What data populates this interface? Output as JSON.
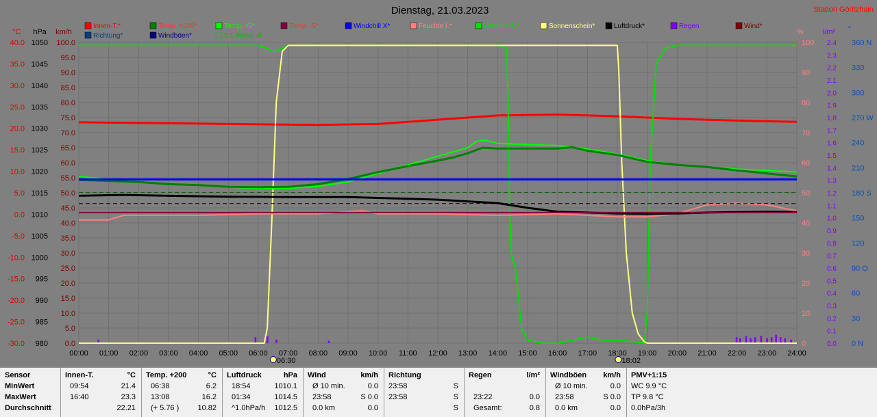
{
  "chart_data": {
    "type": "line",
    "title": "Dienstag, 21.03.2023",
    "station": "Station Göritzhain",
    "background": "#808080",
    "grid": true,
    "x": {
      "min_hours": 0,
      "max_hours": 24,
      "ticks": [
        "00:00",
        "01:00",
        "02:00",
        "03:00",
        "04:00",
        "05:00",
        "06:00",
        "07:00",
        "08:00",
        "09:00",
        "10:00",
        "11:00",
        "12:00",
        "13:00",
        "14:00",
        "15:00",
        "16:00",
        "17:00",
        "18:00",
        "19:00",
        "20:00",
        "21:00",
        "22:00",
        "23:00",
        "24:00"
      ]
    },
    "axes": {
      "temp": {
        "unit": "°C",
        "color": "#e00000",
        "range": [
          -30,
          40
        ],
        "ticks": [
          "40.0",
          "35.0",
          "30.0",
          "25.0",
          "20.0",
          "15.0",
          "10.0",
          "5.0",
          "0.0",
          "-5.0",
          "-10.0",
          "-15.0",
          "-20.0",
          "-25.0",
          "-30.0"
        ]
      },
      "pressure": {
        "unit": "hPa",
        "color": "#000000",
        "range": [
          980,
          1050
        ],
        "ticks": [
          "1050",
          "1045",
          "1040",
          "1035",
          "1030",
          "1025",
          "1020",
          "1015",
          "1010",
          "1005",
          "1000",
          "995",
          "990",
          "985",
          "980"
        ]
      },
      "wind": {
        "unit": "km/h",
        "color": "#800000",
        "range": [
          0,
          100
        ],
        "ticks": [
          "100.0",
          "95.0",
          "90.0",
          "85.0",
          "80.0",
          "75.0",
          "70.0",
          "65.0",
          "60.0",
          "55.0",
          "50.0",
          "45.0",
          "40.0",
          "35.0",
          "30.0",
          "25.0",
          "20.0",
          "15.0",
          "10.0",
          "5.0",
          "0.0"
        ]
      },
      "humidity": {
        "unit": "%",
        "color": "#ff8080",
        "range": [
          0,
          100
        ],
        "ticks": [
          "100",
          "90",
          "80",
          "70",
          "60",
          "50",
          "40",
          "30",
          "20",
          "10",
          "0"
        ]
      },
      "rain": {
        "unit": "l/m²",
        "color": "#8000ff",
        "range": [
          0,
          2.5
        ],
        "ticks": [
          "2.4",
          "2.3",
          "2.2",
          "2.1",
          "2.0",
          "1.9",
          "1.8",
          "1.7",
          "1.6",
          "1.5",
          "1.4",
          "1.3",
          "1.2",
          "1.1",
          "1.0",
          "0.9",
          "0.8",
          "0.7",
          "0.6",
          "0.5",
          "0.4",
          "0.3",
          "0.2",
          "0.1",
          "0.0"
        ]
      },
      "direction": {
        "unit": "°",
        "color": "#0050c0",
        "range": [
          0,
          360
        ],
        "ticks": [
          "360 N",
          "330",
          "300",
          "270 W",
          "240",
          "210",
          "180 S",
          "150",
          "120",
          "90 O",
          "60",
          "30",
          "0 N"
        ]
      }
    },
    "legend": [
      {
        "label": "Innen-T.*",
        "color": "#ff0000"
      },
      {
        "label": "Temp. +200*",
        "color": "#008000"
      },
      {
        "label": "Temp. +5*",
        "color": "#00ff00"
      },
      {
        "label": "Temp. -5*",
        "color": "#800040"
      },
      {
        "label": "Windchill X*",
        "color": "#0000ff"
      },
      {
        "label": "Feuchte I.*",
        "color": "#ff8080"
      },
      {
        "label": "Feuchte A.*",
        "color": "#00e000"
      },
      {
        "label": "Sonnenschein*",
        "color": "#ffff80"
      },
      {
        "label": "Luftdruck*",
        "color": "#000000"
      },
      {
        "label": "Regen",
        "color": "#8000ff"
      },
      {
        "label": "Wind*",
        "color": "#800000"
      },
      {
        "label": "Richtung*",
        "color": "#004080"
      },
      {
        "label": "Windböen*",
        "color": "#000080"
      },
      {
        "label": "5.1 Monat-Ø",
        "color": "#00c000"
      }
    ],
    "markers": [
      {
        "x": 6.5,
        "label": "06:30"
      },
      {
        "x": 18.033,
        "label": "18:02"
      }
    ],
    "series": [
      {
        "name": "Innen-T.*",
        "axis": "temp",
        "color": "#ff0000",
        "width": 3,
        "x": [
          0,
          3,
          5,
          8,
          10,
          12,
          14,
          16,
          18,
          20,
          22,
          24
        ],
        "y": [
          21.4,
          21.2,
          21.0,
          20.8,
          21.0,
          22.0,
          23.0,
          23.2,
          22.8,
          22.2,
          21.8,
          21.5
        ]
      },
      {
        "name": "Feuchte A.*",
        "axis": "humidity",
        "color": "#00e000",
        "width": 2,
        "x": [
          0,
          6.0,
          6.3,
          6.45,
          6.6,
          6.8,
          7.0,
          14.1,
          14.3,
          14.35,
          14.4,
          14.45,
          14.5,
          14.6,
          14.8,
          15.0,
          15.5,
          16.0,
          16.5,
          17.0,
          17.5,
          18.0,
          18.5,
          18.9,
          19.0,
          19.1,
          19.3,
          19.6,
          20.0,
          24
        ],
        "y": [
          99,
          99,
          98,
          97,
          97,
          98,
          99,
          99,
          98,
          80,
          45,
          30,
          28,
          25,
          5,
          1,
          0,
          0,
          1,
          2,
          1,
          1,
          0.5,
          0,
          10,
          60,
          93,
          98,
          99,
          99
        ]
      },
      {
        "name": "Sonnenschein*",
        "axis": "humidity",
        "color": "#ffff80",
        "width": 2,
        "x": [
          0,
          6.2,
          6.3,
          6.45,
          6.6,
          6.8,
          7.0,
          7.3,
          18.0,
          18.05,
          18.15,
          18.3,
          18.5,
          18.7,
          18.9,
          19.0,
          24
        ],
        "y": [
          0,
          0,
          5,
          40,
          80,
          97,
          99,
          99,
          99,
          90,
          60,
          30,
          10,
          3,
          0.5,
          0,
          0
        ]
      },
      {
        "name": "Temp. +5*",
        "axis": "temp",
        "color": "#00ff00",
        "width": 2,
        "x": [
          0,
          2,
          4,
          5,
          6,
          7,
          8,
          9,
          10,
          11,
          12,
          12.5,
          13,
          13.3,
          13.6,
          14,
          15,
          16,
          17,
          18,
          19,
          20,
          21,
          22,
          23,
          24
        ],
        "y": [
          8.8,
          7.5,
          6.8,
          6.3,
          6.0,
          6.0,
          6.5,
          7.5,
          9.5,
          11.5,
          13.5,
          14.5,
          15.5,
          17.0,
          17.2,
          16.5,
          16.2,
          16.0,
          15.2,
          14.0,
          12.5,
          11.5,
          11.0,
          10.5,
          10.2,
          9.8
        ]
      },
      {
        "name": "Temp. +200*",
        "axis": "temp",
        "color": "#008000",
        "width": 3,
        "x": [
          0,
          2,
          3,
          4,
          5,
          6,
          7,
          8,
          9,
          10,
          11,
          12,
          12.5,
          13,
          13.5,
          14,
          15,
          16,
          16.5,
          17,
          18,
          19,
          20,
          21,
          22,
          23,
          24
        ],
        "y": [
          8.0,
          7.5,
          7.0,
          6.8,
          6.4,
          6.3,
          6.4,
          7.0,
          8.2,
          9.8,
          11.2,
          12.5,
          13.2,
          14.2,
          15.5,
          15.3,
          15.3,
          15.3,
          15.6,
          14.8,
          13.8,
          12.2,
          11.5,
          11.0,
          10.2,
          9.5,
          8.8
        ]
      },
      {
        "name": "Windchill X*",
        "axis": "temp",
        "color": "#0000ff",
        "width": 3,
        "x": [
          0,
          24
        ],
        "y": [
          8.1,
          8.1
        ]
      },
      {
        "name": "Feuchte I.*",
        "axis": "humidity",
        "color": "#ff8080",
        "width": 2,
        "x": [
          0,
          1,
          1.5,
          4,
          6,
          8,
          9.5,
          10,
          12,
          14,
          16,
          18,
          19,
          20,
          21,
          22,
          23,
          24
        ],
        "y": [
          41,
          41,
          42.5,
          42.5,
          43,
          43,
          44,
          43,
          43,
          42.5,
          43,
          42,
          42,
          43,
          46,
          46.5,
          46,
          44
        ]
      },
      {
        "name": "Luftdruck*",
        "axis": "pressure",
        "color": "#000000",
        "width": 3,
        "x": [
          0,
          1.5,
          3,
          5,
          7,
          9,
          11,
          12,
          13,
          14,
          15,
          16,
          17,
          18,
          19,
          20,
          21,
          22,
          23,
          24
        ],
        "y": [
          1014.3,
          1014.5,
          1014.3,
          1014.1,
          1014.0,
          1014.0,
          1013.6,
          1013.4,
          1013.0,
          1012.6,
          1011.5,
          1010.6,
          1010.4,
          1010.2,
          1010.1,
          1010.2,
          1010.4,
          1010.5,
          1010.6,
          1010.5
        ]
      },
      {
        "name": "Temp. -5*",
        "axis": "temp",
        "color": "#800040",
        "width": 2,
        "x": [
          0,
          24
        ],
        "y": [
          0.4,
          0.4
        ]
      },
      {
        "name": "5.1 Monat-Ø",
        "axis": "temp",
        "color": "#006000",
        "dashed": true,
        "width": 1,
        "x": [
          0,
          24
        ],
        "y": [
          5.1,
          5.1
        ]
      },
      {
        "name": "Luftdruck-Ø",
        "axis": "pressure",
        "color": "#000000",
        "dashed": true,
        "width": 1,
        "x": [
          0,
          24
        ],
        "y": [
          1012.5,
          1012.5
        ]
      }
    ],
    "rain_bars": {
      "axis": "rain",
      "color": "#8000ff",
      "x": [
        0.65,
        5.9,
        6.3,
        6.6,
        8.35,
        21.98,
        22.1,
        22.3,
        22.45,
        22.6,
        22.8,
        23.0,
        23.15,
        23.3,
        23.45,
        23.6,
        23.8
      ],
      "y": [
        0.03,
        0.05,
        0.06,
        0.03,
        0.02,
        0.05,
        0.04,
        0.06,
        0.04,
        0.05,
        0.06,
        0.04,
        0.05,
        0.07,
        0.05,
        0.04,
        0.03
      ]
    }
  },
  "stats": {
    "columns": [
      {
        "name": "Sensor",
        "unit": "",
        "rows": [
          [
            "MinWert"
          ],
          [
            "MaxWert"
          ],
          [
            "Durchschnitt"
          ]
        ]
      },
      {
        "name": "Innen-T.",
        "unit": "°C",
        "rows": [
          [
            "09:54",
            "21.4"
          ],
          [
            "16:40",
            "23.3"
          ],
          [
            "",
            "22.21"
          ]
        ]
      },
      {
        "name": "Temp. +200",
        "unit": "°C",
        "rows": [
          [
            "06:38",
            "6.2"
          ],
          [
            "13:08",
            "16.2"
          ],
          [
            "(+ 5.76 )",
            "10.82"
          ]
        ]
      },
      {
        "name": "Luftdruck",
        "unit": "hPa",
        "rows": [
          [
            "18:54",
            "1010.1"
          ],
          [
            "01:34",
            "1014.5"
          ],
          [
            "^1.0hPa/h",
            "1012.5"
          ]
        ]
      },
      {
        "name": "Wind",
        "unit": "km/h",
        "rows": [
          [
            "Ø 10 min.",
            "0.0"
          ],
          [
            "23:58",
            "S 0.0"
          ],
          [
            "0.0 km",
            "0.0"
          ]
        ]
      },
      {
        "name": "Richtung",
        "unit": "",
        "rows": [
          [
            "23:58",
            "S"
          ],
          [
            "23:58",
            "S"
          ],
          [
            "",
            "S"
          ]
        ]
      },
      {
        "name": "Regen",
        "unit": "l/m²",
        "rows": [
          [
            "",
            ""
          ],
          [
            "23:22",
            "0.0"
          ],
          [
            "Gesamt:",
            "0.8"
          ]
        ]
      },
      {
        "name": "Windböen",
        "unit": "km/h",
        "rows": [
          [
            "Ø 10 min.",
            "0.0"
          ],
          [
            "23:58",
            "S 0.0"
          ],
          [
            "0.0 km",
            "0.0"
          ]
        ]
      },
      {
        "name": "PMV+1:15",
        "unit": "",
        "rows": [
          [
            "WC 9.9 °C",
            ""
          ],
          [
            "TP 9.8 °C",
            ""
          ],
          [
            "0.0hPa/3h",
            ""
          ]
        ]
      }
    ]
  }
}
